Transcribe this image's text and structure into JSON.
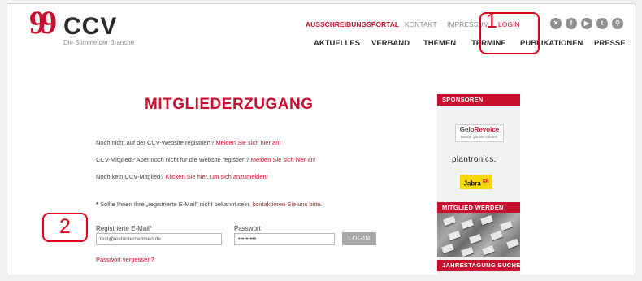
{
  "logo": {
    "brand": "CCV",
    "quote_mark": "99",
    "tagline": "Die Stimme der Branche"
  },
  "top_nav": {
    "ausschreibungsportal": "AUSSCHREIBUNGSPORTAL",
    "kontakt": "KONTAKT",
    "impressum": "IMPRESSUM",
    "login": "LOGIN"
  },
  "social_icons": [
    "xing-icon",
    "facebook-icon",
    "youtube-icon",
    "twitter-icon",
    "search-icon"
  ],
  "main_nav": [
    "AKTUELLES",
    "VERBAND",
    "THEMEN",
    "TERMINE",
    "PUBLIKATIONEN",
    "PRESSE"
  ],
  "page": {
    "headline": "MITGLIEDERZUGANG",
    "p1_text": "Noch nicht auf der CCV-Website registriert?",
    "p1_link": "Melden Sie sich hier an!",
    "p2_text": "CCV-Mitglied? Aber noch nicht für die Website registiert?",
    "p2_link": "Melden Sie sich hier an!",
    "p3_text": "Noch kein CCV-Mitglied?",
    "p3_link": "Klicken Sie hier, um sich anzumelden!",
    "note_star": "*",
    "note_text": "Sollte Ihnen Ihre „registrierte E-Mail\" nicht bekannt sein,",
    "note_link": "kontaktieren Sie uns bitte",
    "note_end": "."
  },
  "form": {
    "email_label": "Registrierte E-Mail*",
    "email_value": "test@testunternehmen.de",
    "password_label": "Passwort",
    "password_value": "•••••••••",
    "login_button": "LOGIN",
    "forgot_link": "Passwort vergessen?"
  },
  "sidebar": {
    "sponsors_heading": "SPONSOREN",
    "sponsor_gelo_a": "Gelo",
    "sponsor_gelo_b": "Revoice",
    "sponsor_gelo_sub": "Besser gut bei Stimme.",
    "sponsor_plantronics": "plantronics.",
    "sponsor_jabra": "Jabra",
    "sponsor_jabra_sup": "GN",
    "mitglied_heading": "MITGLIED WERDEN",
    "jahrestagung_heading": "JAHRESTAGUNG BUCHEN"
  },
  "annotations": {
    "step1": "1",
    "step2": "2"
  },
  "colors": {
    "brand_red": "#c8102e",
    "annotation_red": "#e0001a",
    "button_gray": "#a8a8a8"
  }
}
